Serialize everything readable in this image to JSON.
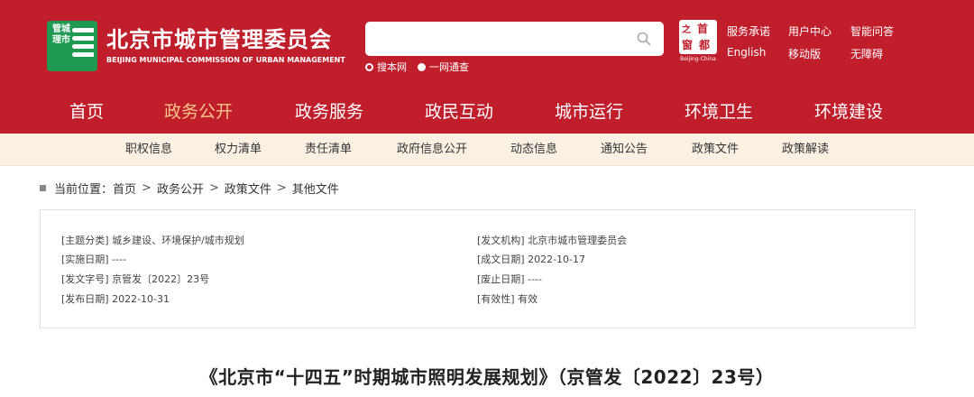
{
  "header": {
    "logo_text": "管城理市",
    "site_name": "北京市城市管理委员会",
    "site_name_en": "BEIJING MUNICIPAL COMMISSION OF URBAN MANAGEMENT",
    "search_placeholder": "",
    "search_options": [
      "搜本网",
      "一网通查"
    ],
    "capital_logo_chars": [
      "之",
      "首",
      "都",
      "窗"
    ],
    "capital_logo_en": "Beijing-China",
    "top_links": [
      "服务承诺",
      "用户中心",
      "智能问答",
      "English",
      "移动版",
      "无障碍"
    ],
    "brand_color": "#c01e2b"
  },
  "main_nav": {
    "items": [
      "首页",
      "政务公开",
      "政务服务",
      "政民互动",
      "城市运行",
      "环境卫生",
      "环境建设"
    ],
    "active": "政务公开"
  },
  "sub_nav": {
    "items": [
      "职权信息",
      "权力清单",
      "责任清单",
      "政府信息公开",
      "动态信息",
      "通知公告",
      "政策文件",
      "政策解读"
    ]
  },
  "breadcrumb": {
    "label": "当前位置：",
    "items": [
      "首页",
      "政务公开",
      "政策文件",
      "其他文件"
    ],
    "separator": ">"
  },
  "info": {
    "left": [
      {
        "label": "[主题分类]",
        "value": "城乡建设、环境保护/城市规划"
      },
      {
        "label": "[实施日期]",
        "value": "----"
      },
      {
        "label": "[发文字号]",
        "value": "京管发〔2022〕23号"
      },
      {
        "label": "[发布日期]",
        "value": "2022-10-31"
      }
    ],
    "right": [
      {
        "label": "[发文机构]",
        "value": "北京市城市管理委员会"
      },
      {
        "label": "[成文日期]",
        "value": "2022-10-17"
      },
      {
        "label": "[废止日期]",
        "value": "----"
      },
      {
        "label": "[有效性]",
        "value": "有效"
      }
    ]
  },
  "document": {
    "title": "《北京市“十四五”时期城市照明发展规划》（京管发〔2022〕23号）"
  }
}
